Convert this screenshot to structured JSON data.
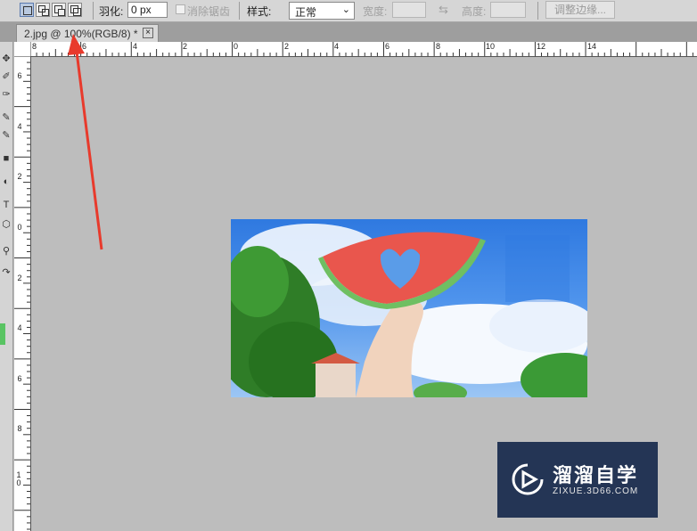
{
  "options": {
    "feather_label": "羽化:",
    "feather_value": "0 px",
    "antialias_label": "消除锯齿",
    "style_label": "样式:",
    "style_value": "正常",
    "width_label": "宽度:",
    "height_label": "高度:",
    "refine_button": "调整边缘..."
  },
  "document": {
    "tab_title": "2.jpg @ 100%(RGB/8) *",
    "close_glyph": "×"
  },
  "rulers": {
    "horizontal": [
      "8",
      "6",
      "4",
      "2",
      "0",
      "2",
      "4",
      "6",
      "8",
      "10",
      "12",
      "14"
    ],
    "vertical": [
      "6",
      "4",
      "2",
      "0",
      "2",
      "4",
      "6",
      "8",
      "10"
    ]
  },
  "watermark": {
    "brand": "溜溜自学",
    "url": "ZIXUE.3D66.COM"
  },
  "colors": {
    "annotation_arrow": "#e83a2c",
    "foreground_swatch": "#59c463"
  }
}
